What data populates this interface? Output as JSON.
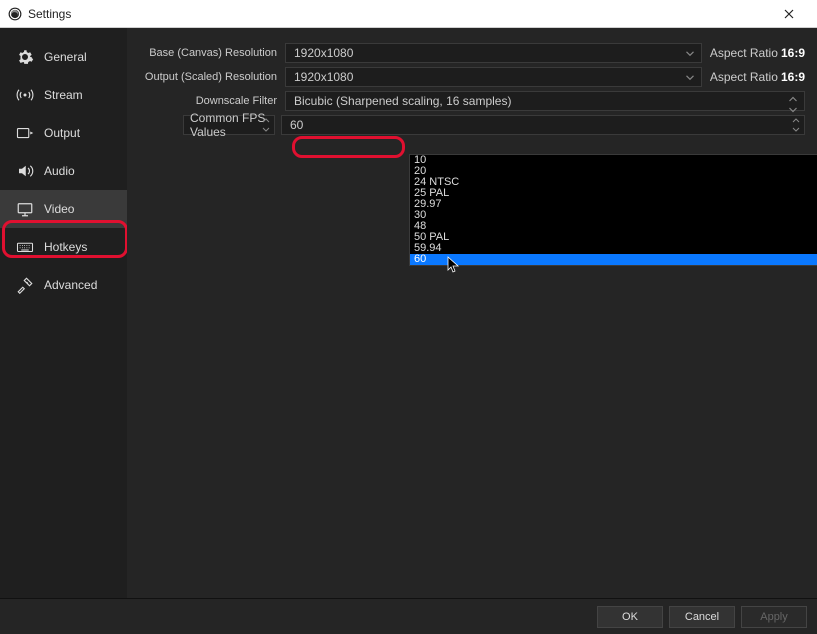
{
  "window": {
    "title": "Settings"
  },
  "sidebar": {
    "items": [
      {
        "label": "General"
      },
      {
        "label": "Stream"
      },
      {
        "label": "Output"
      },
      {
        "label": "Audio"
      },
      {
        "label": "Video"
      },
      {
        "label": "Hotkeys"
      },
      {
        "label": "Advanced"
      }
    ]
  },
  "form": {
    "base_label": "Base (Canvas) Resolution",
    "base_value": "1920x1080",
    "output_label": "Output (Scaled) Resolution",
    "output_value": "1920x1080",
    "aspect_label": "Aspect Ratio",
    "aspect_value": "16:9",
    "filter_label": "Downscale Filter",
    "filter_value": "Bicubic (Sharpened scaling, 16 samples)",
    "fps_type_label": "Common FPS Values",
    "fps_value": "60",
    "fps_options": [
      "10",
      "20",
      "24 NTSC",
      "25 PAL",
      "29.97",
      "30",
      "48",
      "50 PAL",
      "59.94",
      "60"
    ]
  },
  "footer": {
    "ok": "OK",
    "cancel": "Cancel",
    "apply": "Apply"
  }
}
